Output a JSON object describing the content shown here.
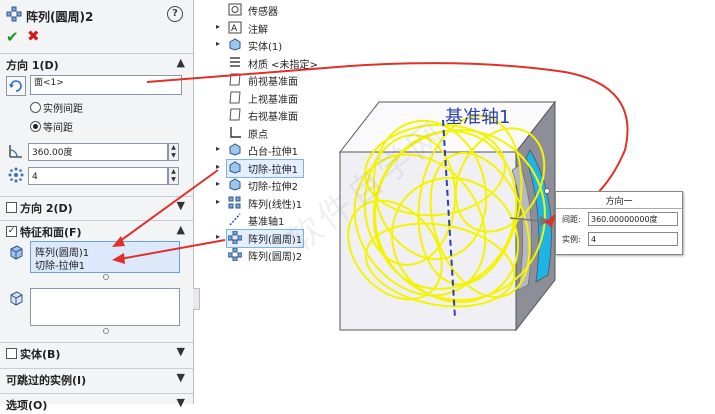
{
  "pm": {
    "title": "阵列(圆周)2",
    "help": "?",
    "ok": "✔",
    "cancel": "✖",
    "direction1": {
      "label": "方向 1(D)",
      "face_value": "面<1>",
      "radio_instance_spacing": "实例间距",
      "radio_equal_spacing": "等间距",
      "angle": "360.00度",
      "count": "4"
    },
    "direction2": {
      "label": "方向 2(D)"
    },
    "features": {
      "label": "特征和面(F)",
      "items": [
        "阵列(圆周)1",
        "切除-拉伸1"
      ]
    },
    "bodies": {
      "label": "实体(B)"
    },
    "skip": {
      "label": "可跳过的实例(I)"
    },
    "options": {
      "label": "选项(O)"
    }
  },
  "tree": [
    {
      "label": "传感器",
      "arrow": "",
      "icon": "sensor-icon"
    },
    {
      "label": "注解",
      "arrow": "▸",
      "icon": "annotation-icon"
    },
    {
      "label": "实体(1)",
      "arrow": "▸",
      "icon": "solid-bodies-icon"
    },
    {
      "label": "材质 <未指定>",
      "arrow": "",
      "icon": "material-icon"
    },
    {
      "label": "前视基准面",
      "arrow": "",
      "icon": "plane-icon"
    },
    {
      "label": "上视基准面",
      "arrow": "",
      "icon": "plane-icon"
    },
    {
      "label": "右视基准面",
      "arrow": "",
      "icon": "plane-icon"
    },
    {
      "label": "原点",
      "arrow": "",
      "icon": "origin-icon"
    },
    {
      "label": "凸台-拉伸1",
      "arrow": "▸",
      "icon": "boss-extrude-icon"
    },
    {
      "label": "切除-拉伸1",
      "arrow": "▸",
      "icon": "cut-extrude-icon"
    },
    {
      "label": "切除-拉伸2",
      "arrow": "▸",
      "icon": "cut-extrude-icon"
    },
    {
      "label": "阵列(线性)1",
      "arrow": "▸",
      "icon": "linear-pattern-icon"
    },
    {
      "label": "基准轴1",
      "arrow": "",
      "icon": "axis-icon"
    },
    {
      "label": "阵列(圆周)1",
      "arrow": "▸",
      "icon": "circular-pattern-icon"
    },
    {
      "label": "阵列(圆周)2",
      "arrow": "",
      "icon": "circular-pattern-icon"
    }
  ],
  "viewport": {
    "axis_label": "基准轴1",
    "watermark": "软件自学网"
  },
  "callout": {
    "title": "方向一",
    "spacing_label": "间距:",
    "spacing_value": "360.00000000度",
    "instances_label": "实例:",
    "instances_value": "4"
  },
  "colors": {
    "panel_bg": "#f3f4f6",
    "arrow_red": "#e0302a",
    "selection_blue": "#dbe9fb",
    "pattern_yellow": "#f4f400",
    "axis_blue": "#2a3fb5",
    "cube_light": "#f2f2f6",
    "cube_dark": "#8c8c96",
    "face_cyan": "#1eb4e6"
  }
}
